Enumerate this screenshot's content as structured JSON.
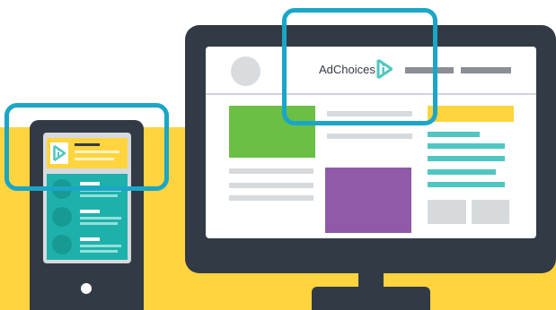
{
  "monitor": {
    "adchoices_label": "AdChoices",
    "icon": "adchoices-icon"
  },
  "phone": {
    "icon": "adchoices-icon",
    "list_item_count": 3
  },
  "colors": {
    "background_yellow": "#ffd43f",
    "device_dark": "#323b45",
    "highlight_teal": "#1aa6c7",
    "accent_teal": "#4fc6c1",
    "green_block": "#6bbf45",
    "purple_block": "#8f5aa8",
    "placeholder_gray": "#d6dadd"
  }
}
